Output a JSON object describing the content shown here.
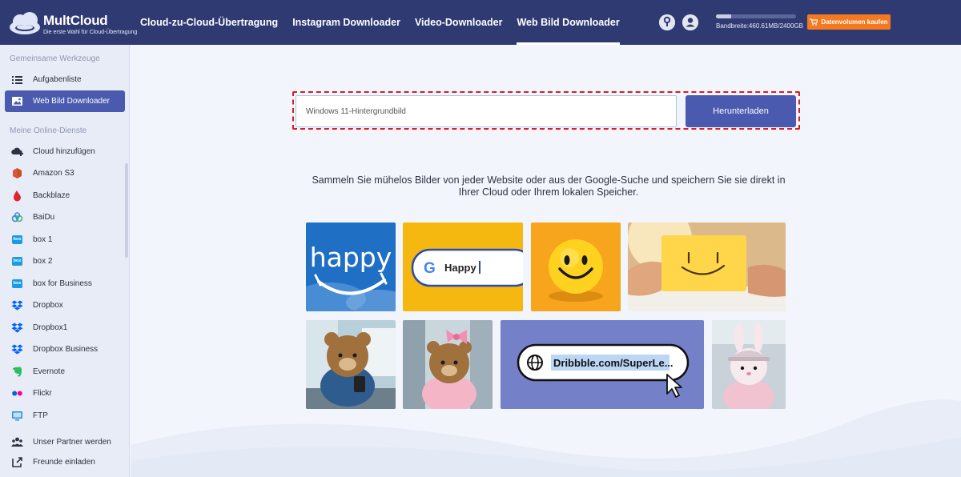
{
  "header": {
    "brand_name": "MultCloud",
    "brand_tagline": "Die erste Wahl für Cloud-Übertragung",
    "nav": [
      {
        "label": "Cloud-zu-Cloud-Übertragung",
        "active": false
      },
      {
        "label": "Instagram Downloader",
        "active": false
      },
      {
        "label": "Video-Downloader",
        "active": false
      },
      {
        "label": "Web Bild Downloader",
        "active": true
      }
    ],
    "icons": [
      "help-icon",
      "user-icon"
    ],
    "bandwidth_text": "Bandbreite:460.61MB/2400GB",
    "bandwidth_used_fraction": 0.19,
    "buy_button_label": "Datenvolumen kaufen"
  },
  "sidebar": {
    "section_tools": "Gemeinsame Werkzeuge",
    "tools": [
      {
        "label": "Aufgabenliste",
        "icon": "list-icon",
        "active": false
      },
      {
        "label": "Web Bild Downloader",
        "icon": "image-icon",
        "active": true
      }
    ],
    "section_services": "Meine Online-Dienste",
    "services": [
      {
        "label": "Cloud hinzufügen",
        "icon": "add-cloud-icon"
      },
      {
        "label": "Amazon S3",
        "icon": "amazon-s3-icon"
      },
      {
        "label": "Backblaze",
        "icon": "backblaze-icon"
      },
      {
        "label": "BaiDu",
        "icon": "baidu-icon"
      },
      {
        "label": "box 1",
        "icon": "box-icon"
      },
      {
        "label": "box 2",
        "icon": "box-icon"
      },
      {
        "label": "box for Business",
        "icon": "box-icon"
      },
      {
        "label": "Dropbox",
        "icon": "dropbox-icon"
      },
      {
        "label": "Dropbox1",
        "icon": "dropbox-icon"
      },
      {
        "label": "Dropbox Business",
        "icon": "dropbox-icon"
      },
      {
        "label": "Evernote",
        "icon": "evernote-icon"
      },
      {
        "label": "Flickr",
        "icon": "flickr-icon"
      },
      {
        "label": "FTP",
        "icon": "ftp-icon"
      }
    ],
    "bottom": [
      {
        "label": "Unser Partner werden",
        "icon": "partner-icon"
      },
      {
        "label": "Freunde einladen",
        "icon": "share-icon"
      }
    ],
    "box_badge_text": "box"
  },
  "main": {
    "search_value": "Windows 11-Hintergrundbild",
    "download_button": "Herunterladen",
    "description": "Sammeln Sie mühelos Bilder von jeder Website oder aus der Google-Suche und speichern Sie sie direkt in Ihrer Cloud oder Ihrem lokalen Speicher.",
    "thumbs": {
      "happy_text": "happy",
      "google_letter": "G",
      "google_query": "Happy",
      "url_text": "Dribbble.com/SuperLe..."
    }
  },
  "colors": {
    "header_bg": "#2f3a72",
    "accent": "#4a5aaf",
    "buy_orange": "#f47920",
    "highlight_red": "#e01b1b"
  }
}
